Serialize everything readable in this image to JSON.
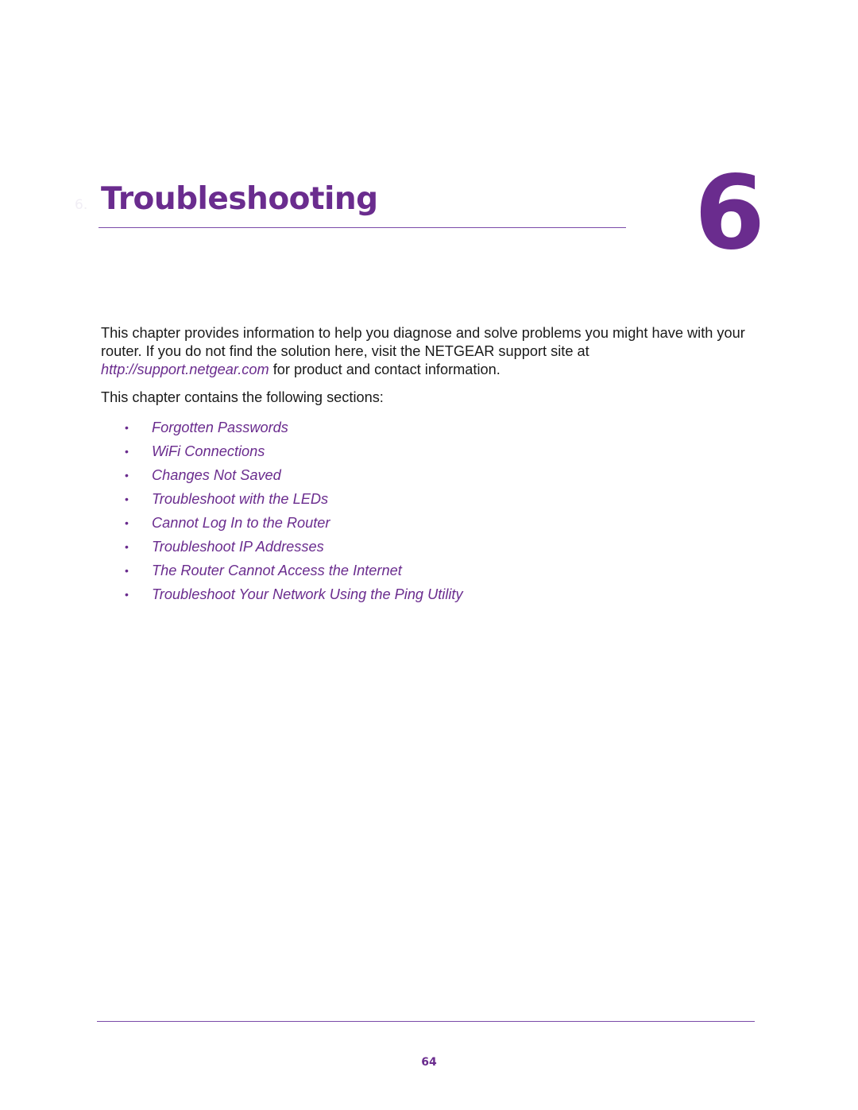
{
  "chapter": {
    "faint_label": "6.",
    "title": "Troubleshooting",
    "number": "6"
  },
  "intro": {
    "text_before_link": "This chapter provides information to help you diagnose and solve problems you might have with your router. If you do not find the solution here, visit the NETGEAR support site at ",
    "link": "http://support.netgear.com",
    "text_after_link": " for product and contact information."
  },
  "sections_intro": "This chapter contains the following sections:",
  "sections": [
    {
      "label": "Forgotten Passwords"
    },
    {
      "label": "WiFi Connections"
    },
    {
      "label": "Changes Not Saved"
    },
    {
      "label": "Troubleshoot with the LEDs"
    },
    {
      "label": "Cannot Log In to the Router"
    },
    {
      "label": "Troubleshoot IP Addresses"
    },
    {
      "label": "The Router Cannot Access the Internet"
    },
    {
      "label": "Troubleshoot Your Network Using the Ping Utility"
    }
  ],
  "bullet_glyph": "•",
  "footer": {
    "page_number": "64"
  },
  "colors": {
    "accent": "#6a2c8e"
  }
}
